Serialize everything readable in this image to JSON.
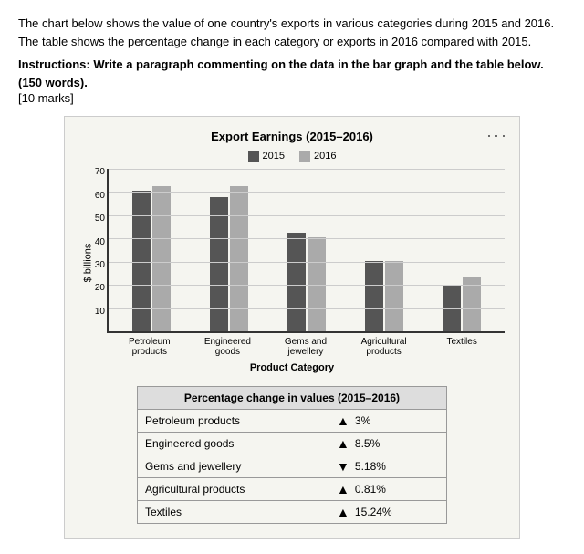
{
  "intro": {
    "text1": "The chart below shows the value of one country's exports in various categories during 2015 and 2016. The table shows the percentage change in each category or exports in 2016 compared with 2015.",
    "instruction": "Instructions: Write a paragraph commenting on the data in the bar graph and the table below. (150 words).",
    "marks": "[10 marks]"
  },
  "chart": {
    "title": "Export Earnings (2015–2016)",
    "legend_2015": "2015",
    "legend_2016": "2016",
    "y_axis_label": "$ billions",
    "y_ticks": [
      "70",
      "60",
      "50",
      "40",
      "30",
      "20",
      "10"
    ],
    "x_labels": [
      "Petroleum\nproducts",
      "Engineered\ngoods",
      "Gems and\njewellery",
      "Agricultural\nproducts",
      "Textiles"
    ],
    "x_axis_label": "Product Category",
    "bars": [
      {
        "label": "Petroleum products",
        "val2015": 60,
        "val2016": 62
      },
      {
        "label": "Engineered goods",
        "val2015": 57,
        "val2016": 62
      },
      {
        "label": "Gems and jewellery",
        "val2015": 42,
        "val2016": 40
      },
      {
        "label": "Agricultural products",
        "val2015": 30,
        "val2016": 30
      },
      {
        "label": "Textiles",
        "val2015": 20,
        "val2016": 23
      }
    ],
    "max_val": 70
  },
  "table": {
    "header": "Percentage change in values (2015–2016)",
    "rows": [
      {
        "category": "Petroleum products",
        "direction": "up",
        "value": "3%"
      },
      {
        "category": "Engineered goods",
        "direction": "up",
        "value": "8.5%"
      },
      {
        "category": "Gems and jewellery",
        "direction": "down",
        "value": "5.18%"
      },
      {
        "category": "Agricultural products",
        "direction": "up",
        "value": "0.81%"
      },
      {
        "category": "Textiles",
        "direction": "up",
        "value": "15.24%"
      }
    ]
  },
  "three_dots": "···"
}
